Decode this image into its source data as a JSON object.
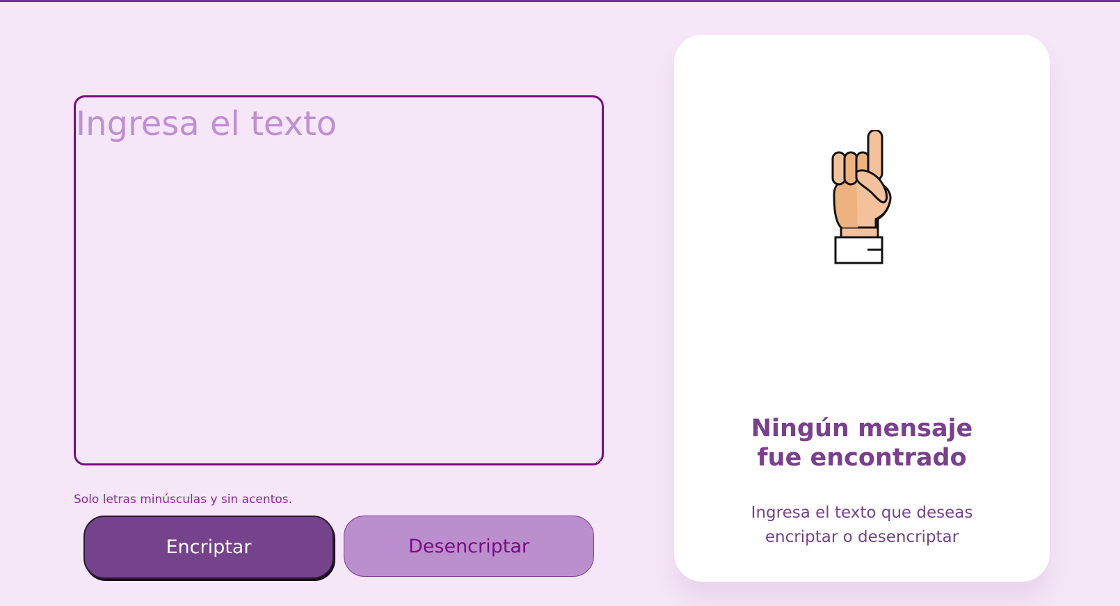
{
  "input": {
    "placeholder": "Ingresa el texto",
    "value": ""
  },
  "hint": "Solo letras minúsculas y sin acentos.",
  "buttons": {
    "encrypt_label": "Encriptar",
    "decrypt_label": "Desencriptar"
  },
  "output": {
    "illustration": "hand-pointing-up-icon",
    "title": "Ningún mensaje\nfue encontrado",
    "description": "Ingresa el texto que deseas encriptar o desencriptar"
  },
  "colors": {
    "background": "#f5e7f7",
    "accent": "#75438b",
    "input_border": "#7c0a82",
    "secondary_button": "#bb8ece",
    "top_bar": "#6d2fa8"
  }
}
